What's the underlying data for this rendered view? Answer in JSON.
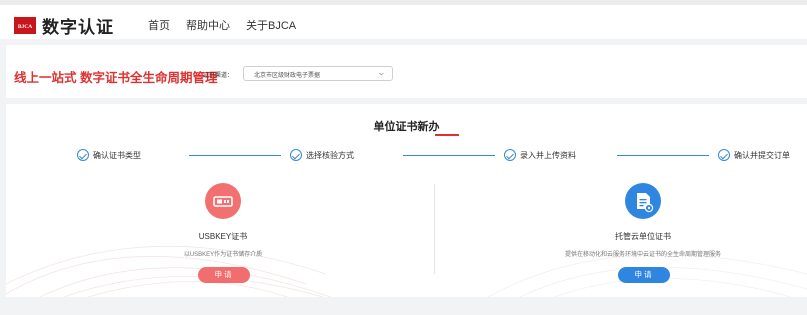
{
  "header": {
    "logo_badge": "BJCA",
    "logo_text": "数字认证",
    "nav": [
      "首页",
      "帮助中心",
      "关于BJCA"
    ]
  },
  "filter_bar": {
    "slogan": "线上一站式 数字证书全生命周期管理",
    "channel_label": "证书渠道：",
    "channel_value": "北京市区级财政电子票据"
  },
  "main": {
    "title": "单位证书新办",
    "steps": [
      "确认证书类型",
      "选择核验方式",
      "录入并上传资料",
      "确认并提交订单"
    ],
    "cards": [
      {
        "icon": "usbkey-icon",
        "title": "USBKEY证书",
        "desc": "以USBKEY作为证书储存介质",
        "button": "申请",
        "color": "#f26d6d"
      },
      {
        "icon": "cloud-document-icon",
        "title": "托管云单位证书",
        "desc": "提供在移动化和云服务环境中云证书的全生命周期管理服务",
        "button": "申请",
        "color": "#2f86e0"
      }
    ]
  },
  "colors": {
    "accent_red": "#e03030",
    "step_blue": "#3a86d8"
  }
}
